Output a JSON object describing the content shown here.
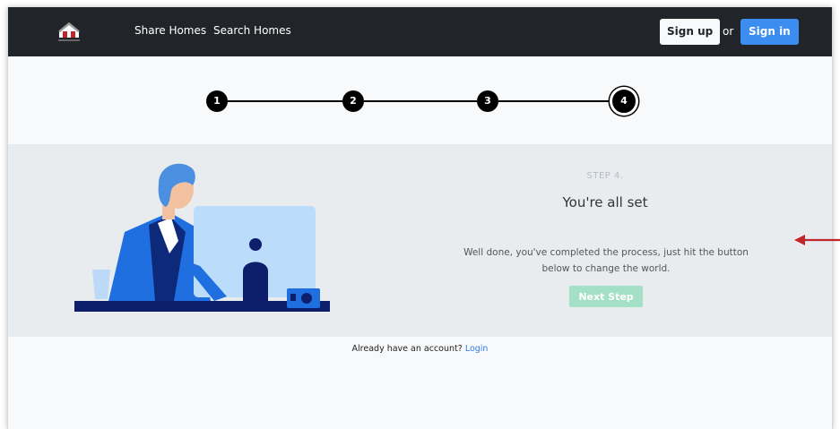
{
  "navbar": {
    "logo_icon": "house-logo-icon",
    "links": [
      "Share Homes",
      "Search Homes"
    ],
    "signup_label": "Sign up",
    "or_text": "or",
    "signin_label": "Sign in"
  },
  "stepper": {
    "steps": [
      "1",
      "2",
      "3",
      "4"
    ],
    "active_step": 4
  },
  "panel": {
    "step_label": "STEP 4.",
    "title": "You're all set",
    "description": "Well done, you've completed the process, just hit the button below to change the world.",
    "next_button": "Next Step"
  },
  "footer": {
    "prompt": "Already have an account?",
    "login_link": "Login"
  },
  "colors": {
    "navbar_bg": "#212529",
    "signin_bg": "#3b8ef0",
    "next_bg": "#a4e0c8",
    "panel_bg": "#e9ecef",
    "annotation_arrow": "#c0272d"
  }
}
